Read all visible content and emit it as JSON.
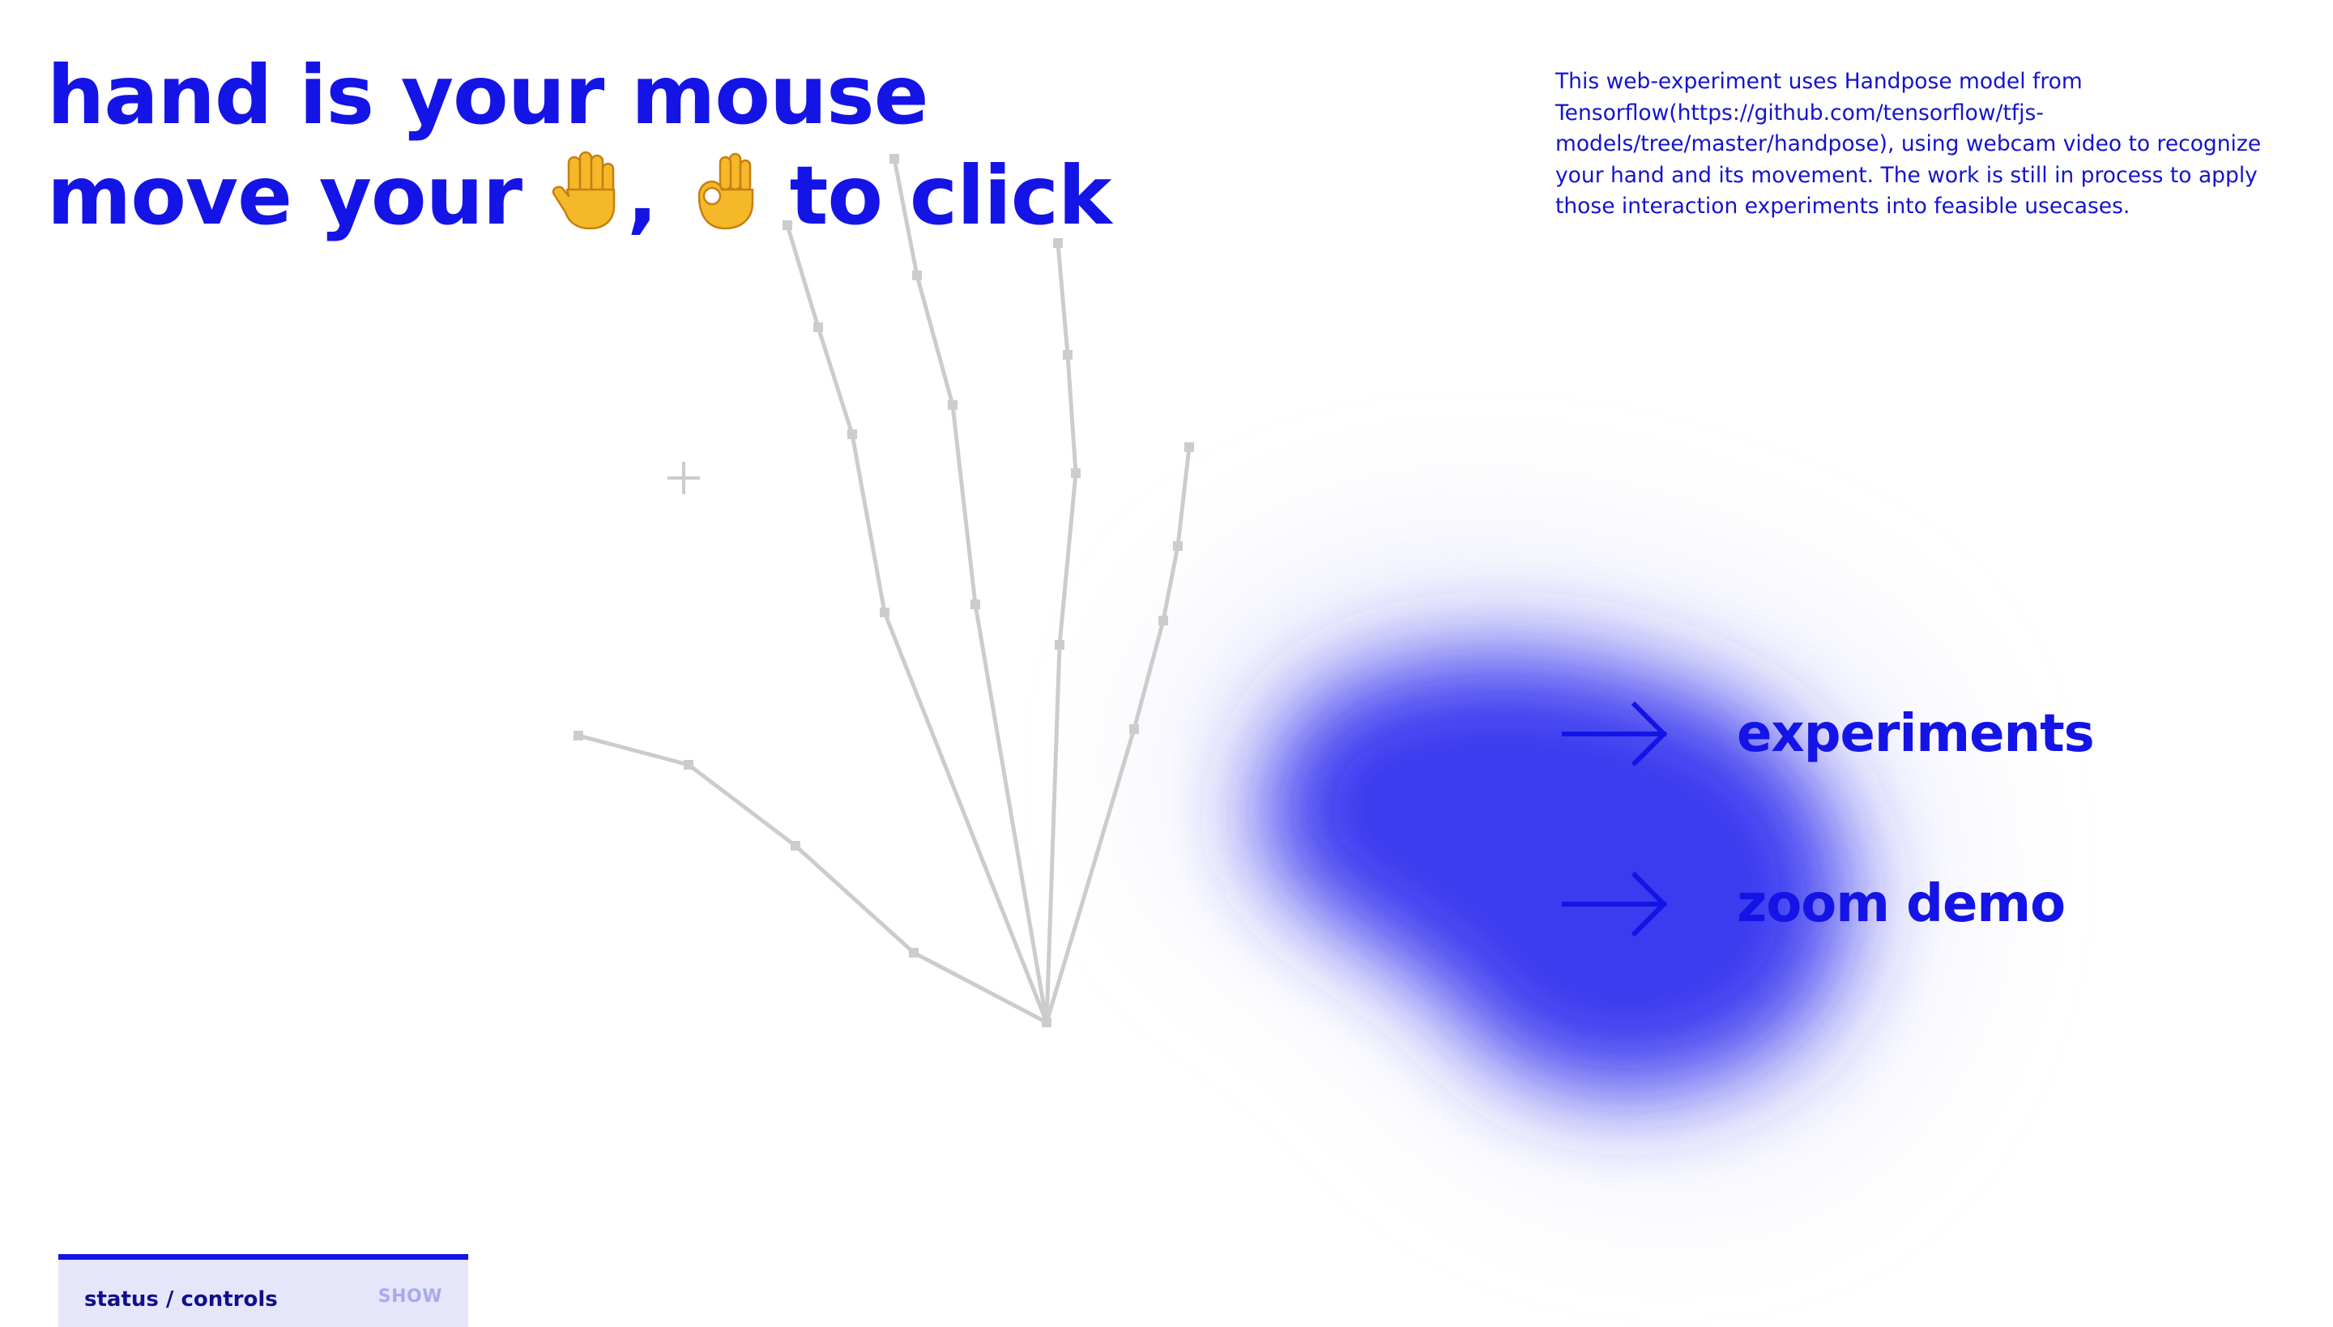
{
  "headline": {
    "line1": "hand is your mouse",
    "line2_prefix": "move your",
    "line2_separator": ",",
    "line2_suffix": "to click",
    "emoji_icons": [
      "raised-hand-icon",
      "ok-hand-icon"
    ]
  },
  "description": "This web-experiment uses Handpose model from Tensorflow(https://github.com/tensorflow/tfjs-models/tree/master/handpose), using webcam video to recognize your hand and its movement. The work is still in process to apply those interaction experiments into feasible usecases.",
  "nav": {
    "items": [
      {
        "label": "experiments",
        "icon": "arrow-right-icon"
      },
      {
        "label": "zoom demo",
        "icon": "arrow-right-icon"
      }
    ]
  },
  "status_panel": {
    "title": "status / controls",
    "toggle_label": "SHOW"
  },
  "colors": {
    "accent": "#1414e6",
    "blob": "#3333f0",
    "skeleton": "#cccccc",
    "panel_bg": "#e6e6fb"
  }
}
